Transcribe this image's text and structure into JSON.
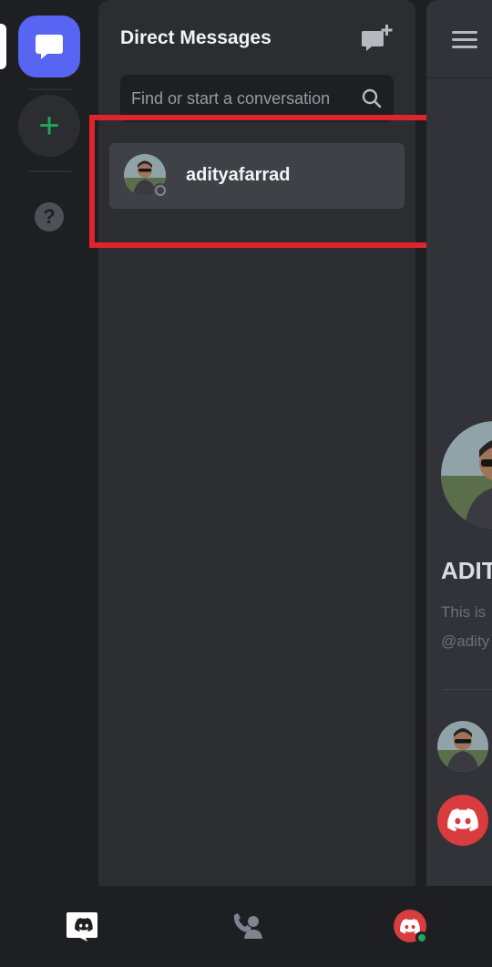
{
  "dm_panel": {
    "title": "Direct Messages",
    "search_placeholder": "Find or start a conversation",
    "conversations": [
      {
        "name": "adityafarrad",
        "status": "offline"
      }
    ]
  },
  "chat": {
    "name_partial": "ADIT",
    "intro_partial": "This is",
    "handle_partial": "@adity"
  },
  "colors": {
    "blurple": "#5865f2",
    "green": "#23a55a",
    "highlight_red": "#e0242b",
    "panel": "#2b2d31",
    "selected_item": "#3f4147"
  },
  "icons": {
    "rail_dm": "chat-bubble-icon",
    "rail_add": "plus-icon",
    "rail_help": "question-icon",
    "new_dm": "new-message-icon",
    "search": "search-icon",
    "menu": "hamburger-icon",
    "nav_home": "discord-logo-icon",
    "nav_friends": "friends-icon",
    "nav_profile": "profile-avatar-icon"
  }
}
